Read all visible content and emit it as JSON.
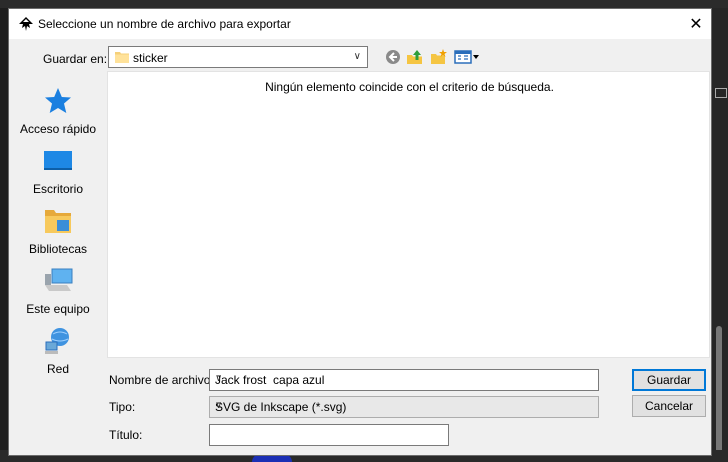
{
  "dialog": {
    "title": "Seleccione un nombre de archivo para exportar",
    "close_glyph": "✕"
  },
  "toolbar": {
    "save_in_label": "Guardar en:",
    "folder": "sticker",
    "buttons": [
      "back-icon",
      "up-folder-icon",
      "new-folder-icon",
      "view-menu-icon"
    ]
  },
  "places": [
    {
      "label": "Acceso rápido",
      "icon": "star-icon"
    },
    {
      "label": "Escritorio",
      "icon": "desktop-icon"
    },
    {
      "label": "Bibliotecas",
      "icon": "libraries-icon"
    },
    {
      "label": "Este equipo",
      "icon": "computer-icon"
    },
    {
      "label": "Red",
      "icon": "network-icon"
    }
  ],
  "file_list": {
    "empty_message": "Ningún elemento coincide con el criterio de búsqueda."
  },
  "form": {
    "filename_label": "Nombre de archivo:",
    "filename_value": "Jack frost  capa azul",
    "type_label": "Tipo:",
    "type_value": "SVG de Inkscape (*.svg)",
    "title_label": "Título:",
    "title_value": ""
  },
  "buttons": {
    "save": "Guardar",
    "cancel": "Cancelar"
  },
  "colors": {
    "accent": "#0078d7",
    "dialog_bg": "#f0f0f0"
  }
}
